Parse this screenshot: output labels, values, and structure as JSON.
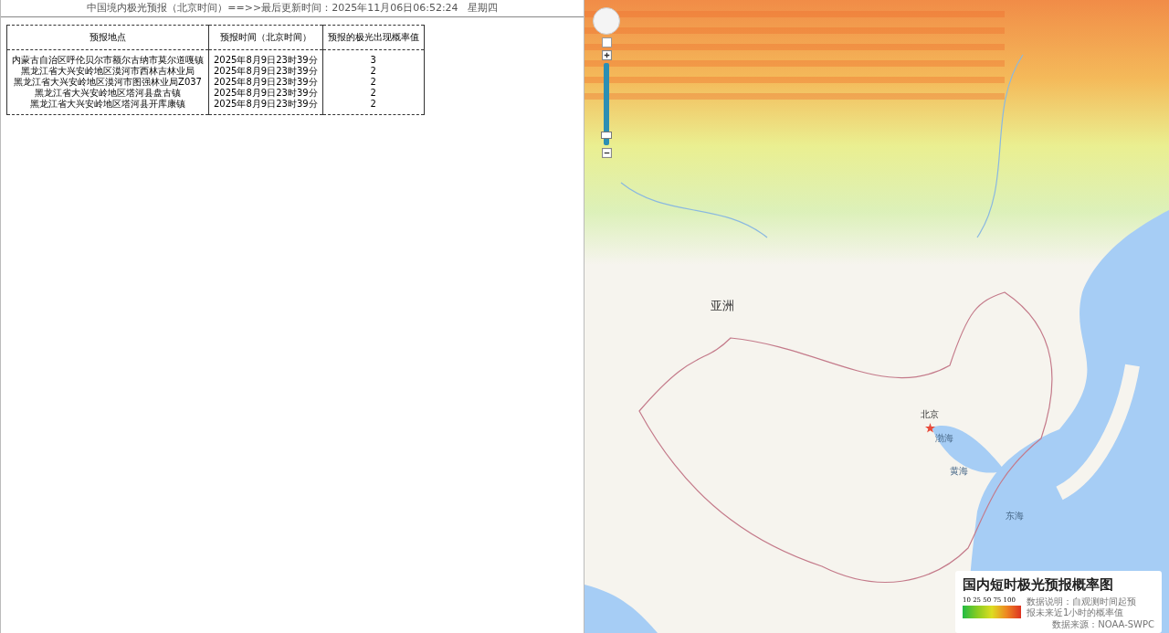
{
  "header": {
    "title": "中国境内极光预报（北京时间）==>>最后更新时间：2025年11月06日06:52:24",
    "weekday": "星期四"
  },
  "table": {
    "columns": [
      "预报地点",
      "预报时间（北京时间）",
      "预报的极光出现概率值"
    ],
    "rows": [
      {
        "place": "内蒙古自治区呼伦贝尔市额尔古纳市莫尔道嘎镇",
        "time": "2025年8月9日23时39分",
        "value": "3"
      },
      {
        "place": "黑龙江省大兴安岭地区漠河市西林吉林业局",
        "time": "2025年8月9日23时39分",
        "value": "2"
      },
      {
        "place": "黑龙江省大兴安岭地区漠河市图强林业局Z037",
        "time": "2025年8月9日23时39分",
        "value": "2"
      },
      {
        "place": "黑龙江省大兴安岭地区塔河县盘古镇",
        "time": "2025年8月9日23时39分",
        "value": "2"
      },
      {
        "place": "黑龙江省大兴安岭地区塔河县开库康镇",
        "time": "2025年8月9日23时39分",
        "value": "2"
      }
    ]
  },
  "map": {
    "zoom": {
      "level": 0.08
    },
    "labels": [
      {
        "kind": "continent",
        "text": "亚洲"
      },
      {
        "kind": "city",
        "text": "北京"
      },
      {
        "kind": "sea",
        "text": "渤海"
      },
      {
        "kind": "sea",
        "text": "黄海"
      },
      {
        "kind": "sea",
        "text": "东海"
      }
    ],
    "legend": {
      "title": "国内短时极光预报概率图",
      "scale": "10 25 50 75 100",
      "note": "数据说明：自观测时间起预报未来近1小时的概率值",
      "source": "数据来源：NOAA-SWPC"
    }
  }
}
